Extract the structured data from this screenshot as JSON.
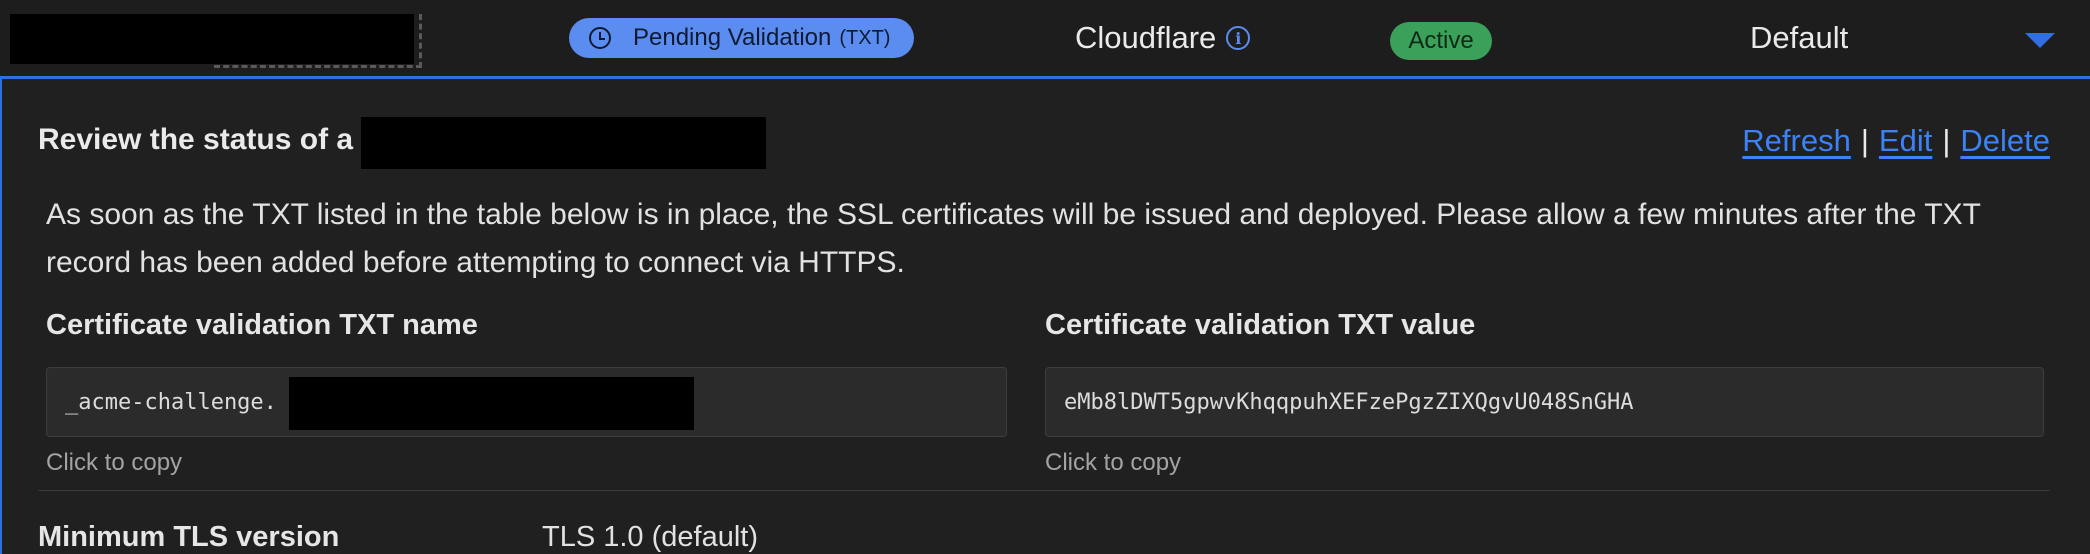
{
  "header": {
    "status_label": "Pending Validation",
    "status_suffix": "(TXT)",
    "provider": "Cloudflare",
    "state_badge": "Active",
    "mode": "Default"
  },
  "panel": {
    "review_prefix": "Review the status of a",
    "actions": {
      "refresh": "Refresh",
      "edit": "Edit",
      "delete": "Delete",
      "separator": "|"
    },
    "description": "As soon as the TXT listed in the table below is in place, the SSL certificates will be issued and deployed. Please allow a few minutes after the TXT record has been added before attempting to connect via HTTPS.",
    "txt_name": {
      "label": "Certificate validation TXT name",
      "value": "_acme-challenge.",
      "hint": "Click to copy"
    },
    "txt_value": {
      "label": "Certificate validation TXT value",
      "value": "eMb8lDWT5gpwvKhqqpuhXEFzePgzZIXQgvU048SnGHA",
      "hint": "Click to copy"
    },
    "tls": {
      "label": "Minimum TLS version",
      "value": "TLS 1.0 (default)"
    }
  },
  "colors": {
    "accent": "#2f6fe0",
    "pending": "#5b8cf0",
    "active": "#3aa05a",
    "background": "#1d1d1d"
  }
}
